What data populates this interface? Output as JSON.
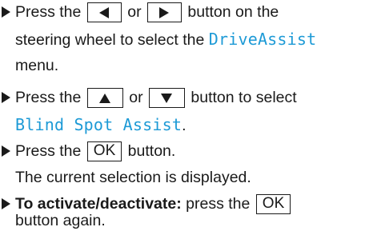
{
  "steps": [
    {
      "lines": [
        {
          "a": "Press the",
          "b": "or",
          "c": "button on the"
        },
        {
          "a": "steering wheel to select the",
          "mono": "DriveAssist"
        },
        {
          "a": "menu."
        }
      ]
    },
    {
      "lines": [
        {
          "a": "Press the",
          "b": "or",
          "c": "button to select"
        },
        {
          "mono": "Blind Spot Assist",
          "end": "."
        }
      ]
    },
    {
      "lines": [
        {
          "a": "Press the",
          "key": "OK",
          "c": "button."
        },
        {
          "a": "The current selection is displayed."
        }
      ]
    },
    {
      "lines": [
        {
          "bold": "To activate/deactivate:",
          "a": " press the",
          "key": "OK"
        },
        {
          "a": "button again."
        }
      ]
    }
  ],
  "icons": {
    "bullet": "triangle-bullet-icon",
    "keys": [
      "left-arrow-key-icon",
      "right-arrow-key-icon",
      "up-arrow-key-icon",
      "down-arrow-key-icon"
    ]
  },
  "colors": {
    "text": "#1a1a1a",
    "menu_term": "#1d9ad6"
  }
}
